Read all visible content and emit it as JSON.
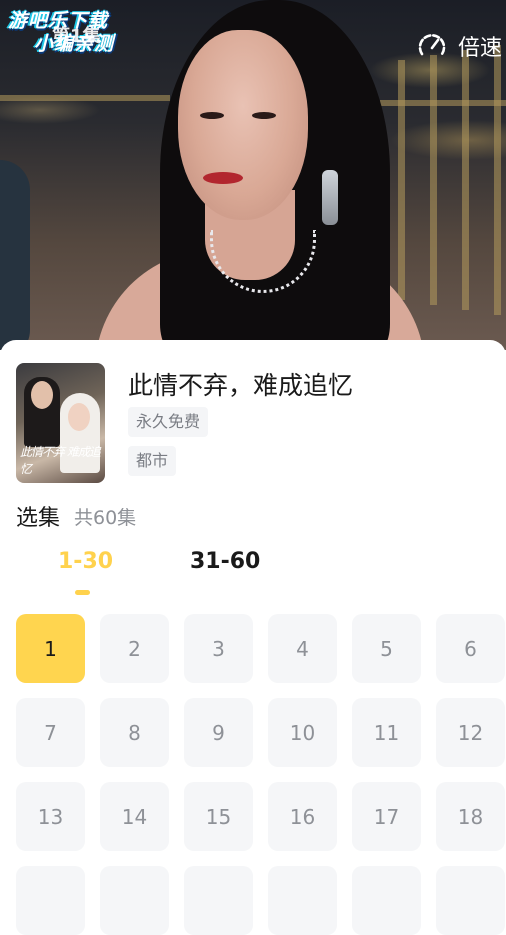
{
  "video": {
    "watermark_line1": "游吧乐下载",
    "watermark_line2": "小编亲测",
    "episode_label": "第1集",
    "speed_label": "倍速"
  },
  "drama": {
    "title": "此情不弃，难成追忆",
    "tags": [
      "永久免费",
      "都市"
    ],
    "poster_text": "此情不弃 难成追忆"
  },
  "episodes": {
    "heading": "选集",
    "total": "共60集",
    "ranges": [
      {
        "label": "1-30",
        "selected": true
      },
      {
        "label": "31-60",
        "selected": false
      }
    ],
    "visible_numbers": [
      "1",
      "2",
      "3",
      "4",
      "5",
      "6",
      "7",
      "8",
      "9",
      "10",
      "11",
      "12",
      "13",
      "14",
      "15",
      "16",
      "17",
      "18"
    ],
    "current": "1"
  },
  "colors": {
    "accent": "#ffd54f",
    "accent_text": "#ffd24d",
    "cell_bg": "#f5f6f8",
    "muted_text": "#8e9197"
  }
}
